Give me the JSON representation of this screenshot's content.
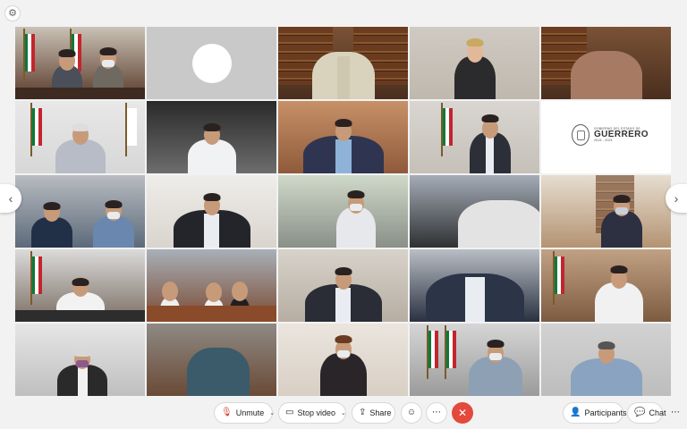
{
  "toolbar": {
    "unmute_label": "Unmute",
    "stop_video_label": "Stop video",
    "share_label": "Share",
    "participants_label": "Participants",
    "chat_label": "Chat"
  },
  "logo": {
    "small_text": "GOBIERNO DEL ESTADO DE",
    "main_text": "GUERRERO",
    "years_text": "2015 - 2021"
  },
  "colors": {
    "end_call": "#e34a3c",
    "mute_icon": "#d0452f",
    "background": "#f2f2f2"
  },
  "icons": {
    "settings": "gear-icon",
    "unmute": "microphone-muted-icon",
    "stop_video": "video-camera-icon",
    "share": "share-screen-icon",
    "reactions": "smiley-icon",
    "more": "more-icon",
    "end_call": "close-icon",
    "participants": "participants-icon",
    "chat": "chat-bubble-icon",
    "previous_page": "chevron-left-icon",
    "next_page": "chevron-right-icon"
  }
}
